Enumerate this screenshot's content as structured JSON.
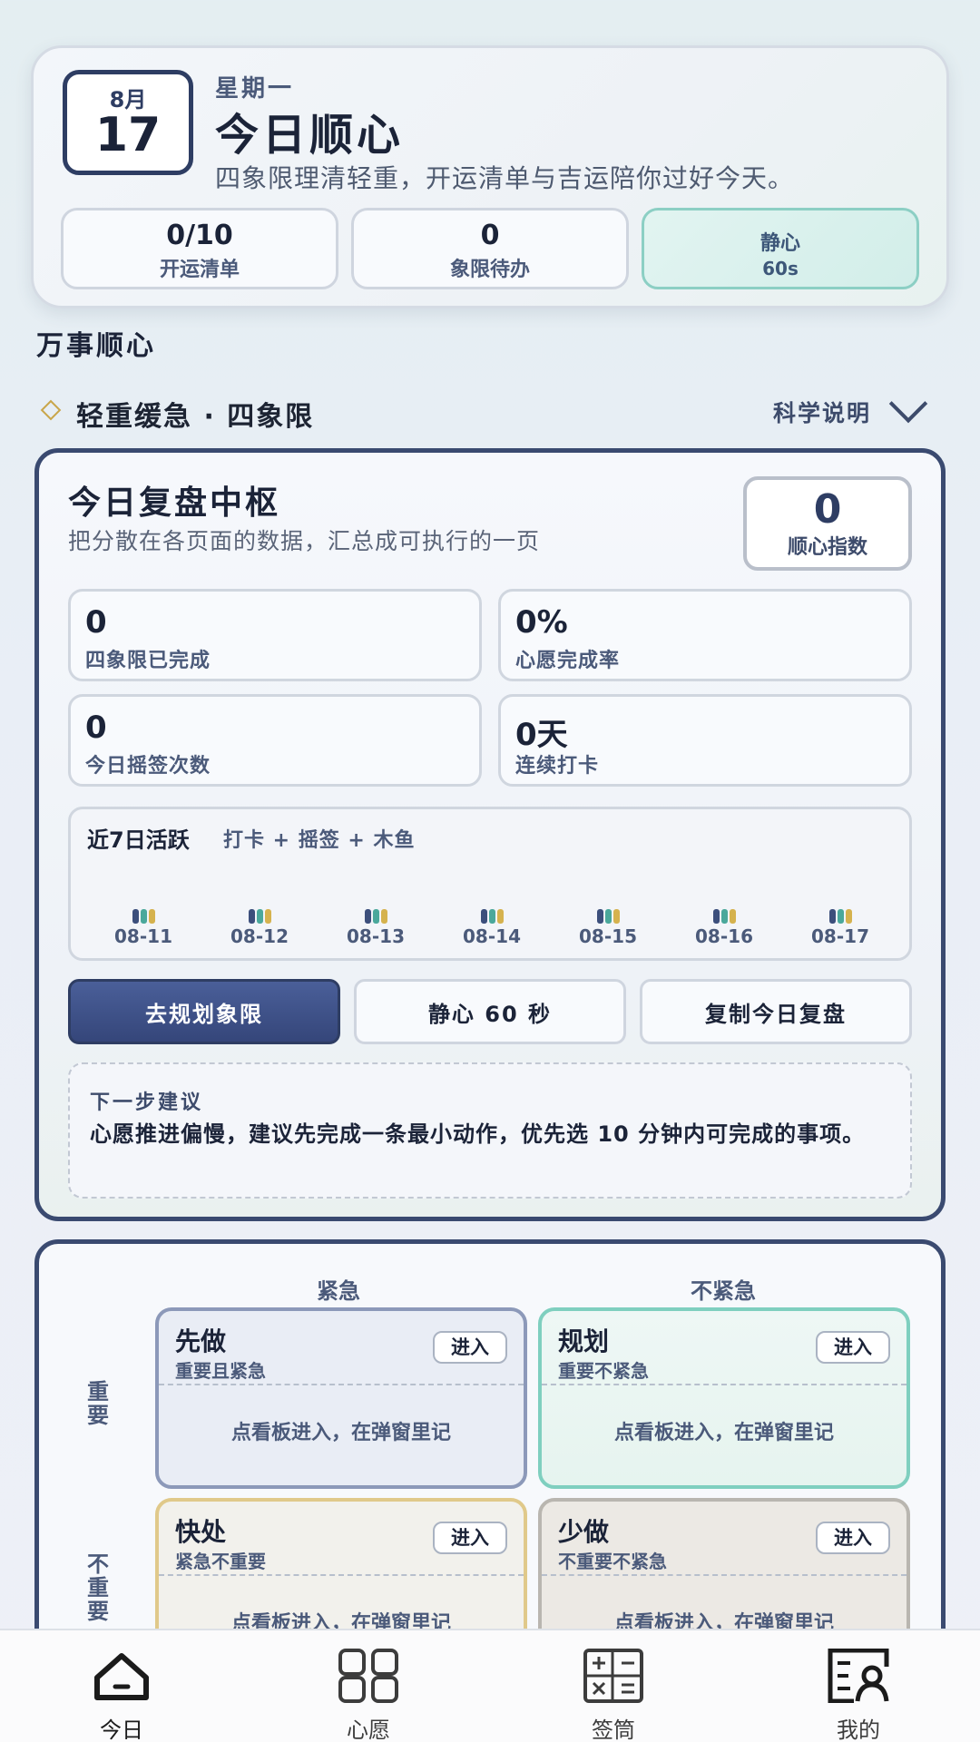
{
  "header": {
    "month": "8月",
    "day": "17",
    "weekday": "星期一",
    "title": "今日顺心",
    "subtitle": "四象限理清轻重，开运清单与吉运陪你过好今天。",
    "stats": [
      {
        "value": "0/10",
        "label": "开运清单"
      },
      {
        "value": "0",
        "label": "象限待办"
      },
      {
        "value": "静心",
        "label": "60s"
      }
    ]
  },
  "section_title": "万事顺心",
  "sub_section": {
    "title": "轻重缓急 · 四象限",
    "science_link": "科学说明"
  },
  "review": {
    "title": "今日复盘中枢",
    "subtitle": "把分散在各页面的数据，汇总成可执行的一页",
    "index_value": "0",
    "index_label": "顺心指数",
    "metrics": [
      {
        "value": "0",
        "label": "四象限已完成"
      },
      {
        "value": "0%",
        "label": "心愿完成率"
      },
      {
        "value": "0",
        "label": "今日摇签次数"
      },
      {
        "value": "0天",
        "label": "连续打卡"
      }
    ],
    "activity": {
      "title": "近7日活跃",
      "legend": "打卡 + 摇签 + 木鱼",
      "days": [
        "08-11",
        "08-12",
        "08-13",
        "08-14",
        "08-15",
        "08-16",
        "08-17"
      ],
      "colors": {
        "checkin": "#3c4f7c",
        "draw": "#4aa89b",
        "fish": "#d5b24e"
      }
    },
    "actions": {
      "plan": "去规划象限",
      "calm": "静心 60 秒",
      "copy": "复制今日复盘"
    },
    "suggestion": {
      "title": "下一步建议",
      "body": "心愿推进偏慢，建议先完成一条最小动作，优先选 10 分钟内可完成的事项。"
    }
  },
  "matrix": {
    "col_urgent": "紧急",
    "col_not_urgent": "不紧急",
    "row_important": "重要",
    "row_not_important": "不重要",
    "quadrants": [
      {
        "title": "先做",
        "sub": "重要且紧急",
        "enter": "进入",
        "hint": "点看板进入，在弹窗里记"
      },
      {
        "title": "规划",
        "sub": "重要不紧急",
        "enter": "进入",
        "hint": "点看板进入，在弹窗里记"
      },
      {
        "title": "快处",
        "sub": "紧急不重要",
        "enter": "进入",
        "hint": "点看板进入，在弹窗里记"
      },
      {
        "title": "少做",
        "sub": "不重要不紧急",
        "enter": "进入",
        "hint": "点看板进入，在弹窗里记"
      }
    ]
  },
  "nav": [
    {
      "label": "今日",
      "icon": "home-icon"
    },
    {
      "label": "心愿",
      "icon": "grid-icon"
    },
    {
      "label": "签筒",
      "icon": "calculator-icon"
    },
    {
      "label": "我的",
      "icon": "profile-icon"
    }
  ]
}
